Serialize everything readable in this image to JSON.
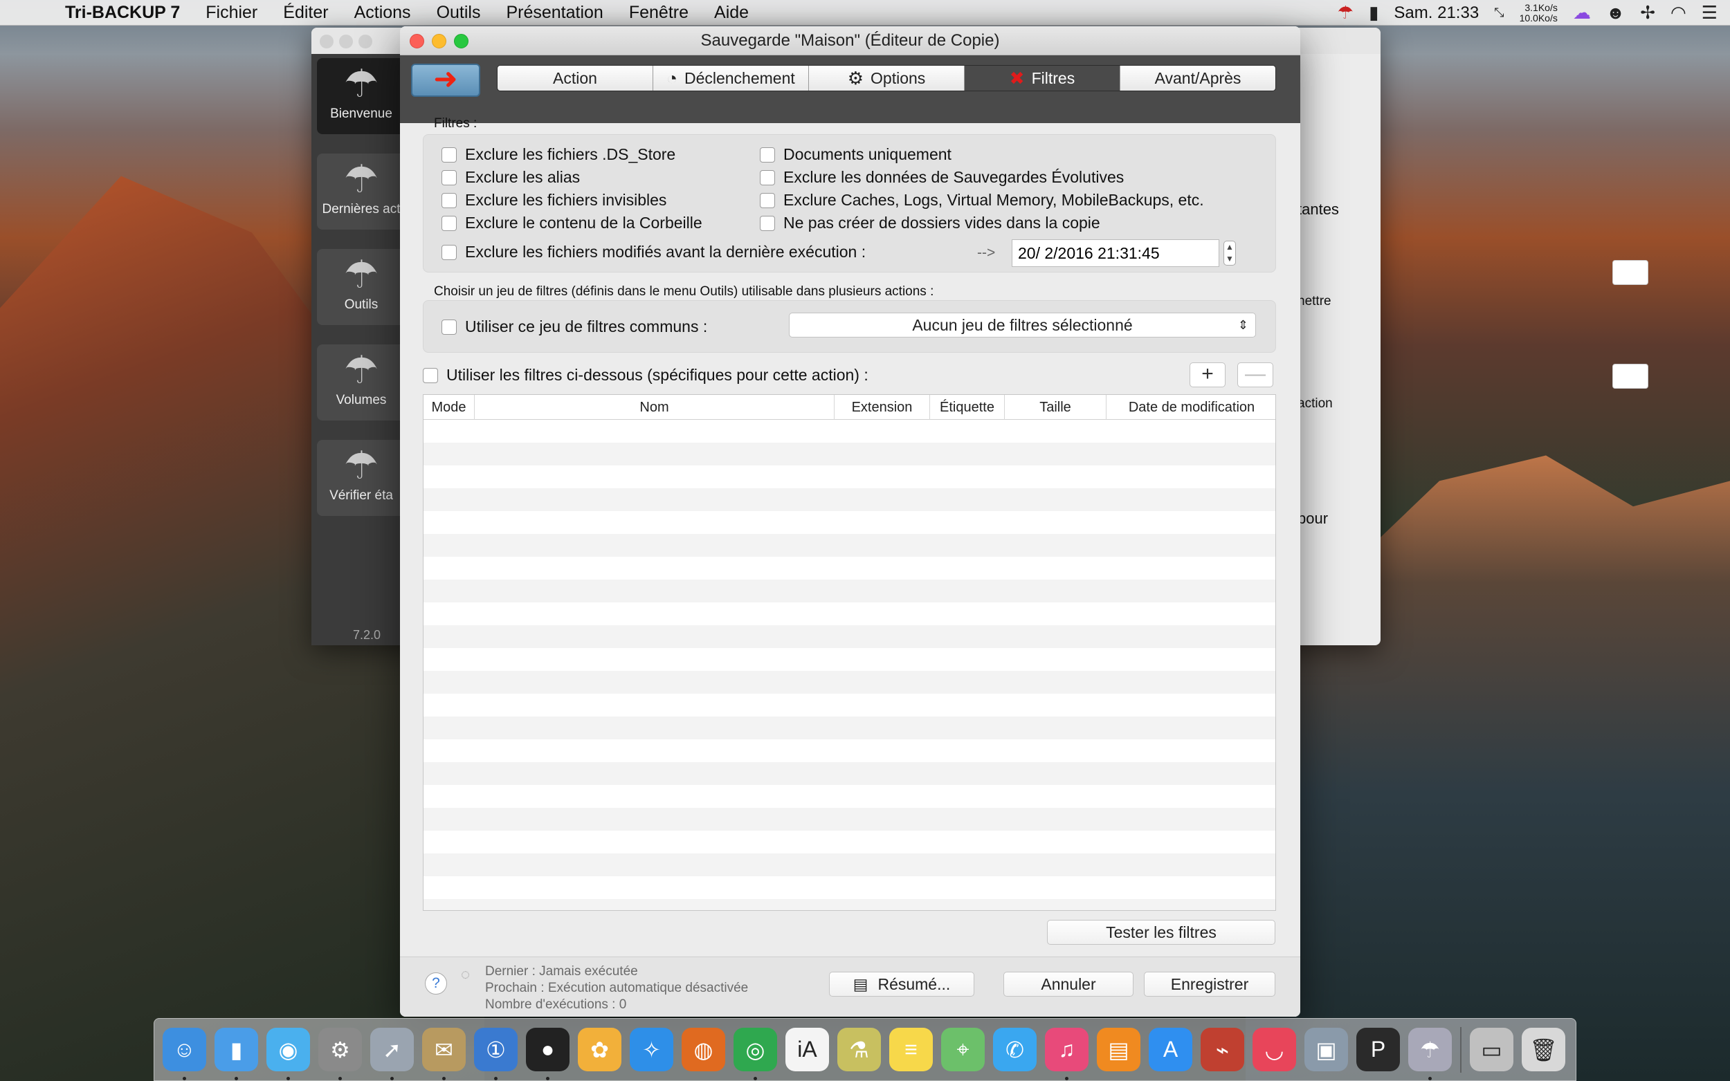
{
  "menubar": {
    "app": "Tri-BACKUP 7",
    "items": [
      "Fichier",
      "Éditer",
      "Actions",
      "Outils",
      "Présentation",
      "Fenêtre",
      "Aide"
    ],
    "clock": "Sam. 21:33",
    "net_up": "3.1Ko/s",
    "net_down": "10.0Ko/s"
  },
  "back_window": {
    "sidebar": [
      "Bienvenue",
      "Dernières act",
      "Outils",
      "Volumes",
      "Vérifier éta"
    ],
    "version": "7.2.0",
    "partial_texts": [
      "tantes",
      "nettre",
      "action",
      "pour"
    ]
  },
  "window": {
    "title": "Sauvegarde \"Maison\" (Éditeur de Copie)"
  },
  "tabs": [
    {
      "label": "Action",
      "icon": ""
    },
    {
      "label": "Déclenchement",
      "icon": "clock-icon"
    },
    {
      "label": "Options",
      "icon": "gear-icon"
    },
    {
      "label": "Filtres",
      "icon": "x-icon"
    },
    {
      "label": "Avant/Après",
      "icon": ""
    }
  ],
  "filters": {
    "heading": "Filtres :",
    "left": [
      "Exclure les fichiers .DS_Store",
      "Exclure les alias",
      "Exclure les fichiers invisibles",
      "Exclure le contenu de la Corbeille"
    ],
    "right": [
      "Documents uniquement",
      "Exclure les données de Sauvegardes Évolutives",
      "Exclure Caches, Logs, Virtual Memory, MobileBackups, etc.",
      "Ne pas créer de dossiers vides dans la copie"
    ],
    "modified": "Exclure les fichiers modifiés avant la dernière exécution :",
    "arrow": "-->",
    "date": "20/  2/2016 21:31:45"
  },
  "filterset": {
    "heading": "Choisir un jeu de filtres (définis dans le menu Outils) utilisable dans plusieurs actions :",
    "checkbox": "Utiliser ce jeu de filtres communs :",
    "popup": "Aucun jeu de filtres sélectionné"
  },
  "specific": {
    "checkbox": "Utiliser les filtres ci-dessous (spécifiques pour cette action) :",
    "add": "+",
    "remove": "—"
  },
  "table": {
    "columns": [
      "Mode",
      "Nom",
      "Extension",
      "Étiquette",
      "Taille",
      "Date de modification"
    ]
  },
  "buttons": {
    "test": "Tester les filtres",
    "summary": "Résumé...",
    "cancel": "Annuler",
    "save": "Enregistrer",
    "help": "?"
  },
  "footer": {
    "last": "Dernier : Jamais exécutée",
    "next": "Prochain : Exécution automatique désactivée",
    "count": "Nombre d'exécutions : 0"
  },
  "dock": [
    {
      "name": "finder-icon",
      "color": "#3d8fe0",
      "glyph": "☺"
    },
    {
      "name": "preview-icon",
      "color": "#4a9de8",
      "glyph": "▮"
    },
    {
      "name": "tweetbot-icon",
      "color": "#4ab0ee",
      "glyph": "◉"
    },
    {
      "name": "system-preferences-icon",
      "color": "#8a8a8a",
      "glyph": "⚙"
    },
    {
      "name": "launchpad-icon",
      "color": "#9aa4b0",
      "glyph": "➚"
    },
    {
      "name": "mail-stamp-icon",
      "color": "#b89a60",
      "glyph": "✉"
    },
    {
      "name": "onepassword-icon",
      "color": "#3a7ad0",
      "glyph": "①"
    },
    {
      "name": "camera-icon",
      "color": "#222",
      "glyph": "●"
    },
    {
      "name": "photos-icon",
      "color": "#f2b03a",
      "glyph": "✿"
    },
    {
      "name": "safari-icon",
      "color": "#2e8fe8",
      "glyph": "✧"
    },
    {
      "name": "firefox-icon",
      "color": "#e06a20",
      "glyph": "◍"
    },
    {
      "name": "chrome-icon",
      "color": "#2fa84f",
      "glyph": "◎"
    },
    {
      "name": "ia-writer-icon",
      "color": "#f4f4f4",
      "glyph": "iA"
    },
    {
      "name": "flask-icon",
      "color": "#c8c060",
      "glyph": "⚗"
    },
    {
      "name": "notes-icon",
      "color": "#f7d84a",
      "glyph": "≡"
    },
    {
      "name": "maps-icon",
      "color": "#6cc06a",
      "glyph": "⌖"
    },
    {
      "name": "messages-icon",
      "color": "#3aa7f0",
      "glyph": "✆"
    },
    {
      "name": "itunes-icon",
      "color": "#e84a7a",
      "glyph": "♫"
    },
    {
      "name": "ibooks-icon",
      "color": "#f08a20",
      "glyph": "▤"
    },
    {
      "name": "app-store-icon",
      "color": "#2f8ff0",
      "glyph": "A"
    },
    {
      "name": "scanner-icon",
      "color": "#c04030",
      "glyph": "⌁"
    },
    {
      "name": "pocket-icon",
      "color": "#e8455a",
      "glyph": "◡"
    },
    {
      "name": "image-capture-icon",
      "color": "#8a9aaa",
      "glyph": "▣"
    },
    {
      "name": "pro-app-icon",
      "color": "#2a2a2a",
      "glyph": "P"
    },
    {
      "name": "tri-backup-icon",
      "color": "#a8a8b8",
      "glyph": "☂"
    },
    {
      "name": "sep",
      "color": "",
      "glyph": ""
    },
    {
      "name": "drawer-icon",
      "color": "#c0c0c0",
      "glyph": "▭"
    },
    {
      "name": "trash-icon",
      "color": "#d8d8d8",
      "glyph": "🗑"
    }
  ]
}
